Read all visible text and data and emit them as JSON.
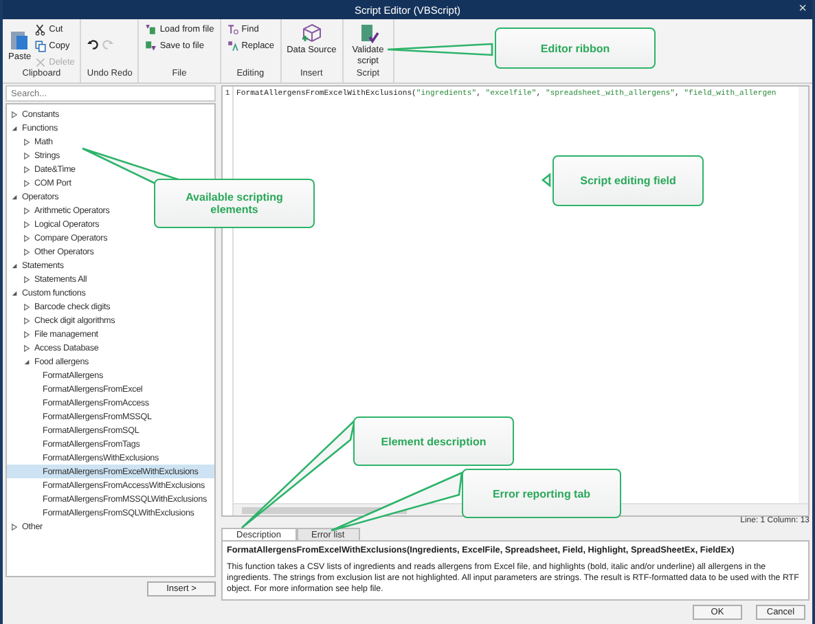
{
  "window": {
    "title": "Script Editor (VBScript)",
    "close": "×"
  },
  "ribbon": {
    "groups": [
      {
        "label": "Clipboard",
        "items": [
          {
            "kind": "large",
            "label": "Paste",
            "disabled": false
          },
          {
            "kind": "small",
            "label": "Cut",
            "disabled": false
          },
          {
            "kind": "small",
            "label": "Copy",
            "disabled": false
          },
          {
            "kind": "small",
            "label": "Delete",
            "disabled": true
          }
        ]
      },
      {
        "label": "Undo Redo",
        "items": [
          {
            "kind": "icon",
            "disabled": false
          },
          {
            "kind": "icon",
            "disabled": true
          }
        ]
      },
      {
        "label": "File",
        "items": [
          {
            "kind": "small",
            "label": "Load from file",
            "disabled": false
          },
          {
            "kind": "small",
            "label": "Save to file",
            "disabled": false
          }
        ]
      },
      {
        "label": "Editing",
        "items": [
          {
            "kind": "small",
            "label": "Find",
            "disabled": false
          },
          {
            "kind": "small",
            "label": "Replace",
            "disabled": false
          }
        ]
      },
      {
        "label": "Insert",
        "items": [
          {
            "kind": "large",
            "label": "Data Source",
            "disabled": false
          }
        ]
      },
      {
        "label": "Script",
        "items": [
          {
            "kind": "large",
            "label": "Validate script",
            "disabled": false
          }
        ]
      }
    ]
  },
  "tree": {
    "search": {
      "placeholder": "Search..."
    },
    "items": [
      {
        "label": "Constants",
        "expanded": false,
        "selected": false
      },
      {
        "label": "Functions",
        "expanded": true,
        "selected": false,
        "children": [
          {
            "label": "Math",
            "expanded": false,
            "selected": false
          },
          {
            "label": "Strings",
            "expanded": false,
            "selected": false
          },
          {
            "label": "Date&Time",
            "expanded": false,
            "selected": false
          },
          {
            "label": "COM Port",
            "expanded": false,
            "selected": false
          }
        ]
      },
      {
        "label": "Operators",
        "expanded": true,
        "selected": false,
        "children": [
          {
            "label": "Arithmetic Operators",
            "expanded": false,
            "selected": false
          },
          {
            "label": "Logical Operators",
            "expanded": false,
            "selected": false
          },
          {
            "label": "Compare Operators",
            "expanded": false,
            "selected": false
          },
          {
            "label": "Other Operators",
            "expanded": false,
            "selected": false
          }
        ]
      },
      {
        "label": "Statements",
        "expanded": true,
        "selected": false,
        "children": [
          {
            "label": "Statements All",
            "expanded": false,
            "selected": false
          }
        ]
      },
      {
        "label": "Custom functions",
        "expanded": true,
        "selected": false,
        "children": [
          {
            "label": "Barcode check digits",
            "expanded": false,
            "selected": false
          },
          {
            "label": "Check digit algorithms",
            "expanded": false,
            "selected": false
          },
          {
            "label": "File management",
            "expanded": false,
            "selected": false
          },
          {
            "label": "Access Database",
            "expanded": false,
            "selected": false
          },
          {
            "label": "Food allergens",
            "expanded": true,
            "selected": false,
            "children": [
              {
                "label": "FormatAllergens",
                "selected": false
              },
              {
                "label": "FormatAllergensFromExcel",
                "selected": false
              },
              {
                "label": "FormatAllergensFromAccess",
                "selected": false
              },
              {
                "label": "FormatAllergensFromMSSQL",
                "selected": false
              },
              {
                "label": "FormatAllergensFromSQL",
                "selected": false
              },
              {
                "label": "FormatAllergensFromTags",
                "selected": false
              },
              {
                "label": "FormatAllergensWithExclusions",
                "selected": false
              },
              {
                "label": "FormatAllergensFromExcelWithExclusions",
                "selected": true
              },
              {
                "label": "FormatAllergensFromAccessWithExclusions",
                "selected": false
              },
              {
                "label": "FormatAllergensFromMSSQLWithExclusions",
                "selected": false
              },
              {
                "label": "FormatAllergensFromSQLWithExclusions",
                "selected": false
              }
            ]
          }
        ]
      },
      {
        "label": "Other",
        "expanded": false,
        "selected": false
      }
    ],
    "insert_button": "Insert >"
  },
  "editor": {
    "line_number": "1",
    "code": [
      {
        "kind": "plain",
        "text": "FormatAllergensFromExcelWithExclusions("
      },
      {
        "kind": "string",
        "text": "\"ingredients\""
      },
      {
        "kind": "plain",
        "text": ", "
      },
      {
        "kind": "string",
        "text": "\"excelfile\""
      },
      {
        "kind": "plain",
        "text": ", "
      },
      {
        "kind": "string",
        "text": "\"spreadsheet_with_allergens\""
      },
      {
        "kind": "plain",
        "text": ", "
      },
      {
        "kind": "string",
        "text": "\"field_with_allergen"
      }
    ],
    "status": "Line: 1 Column: 13"
  },
  "bottom_tabs": [
    {
      "label": "Description",
      "selected": true
    },
    {
      "label": "Error list",
      "selected": false
    }
  ],
  "description": {
    "signature": "FormatAllergensFromExcelWithExclusions(Ingredients, ExcelFile, Spreadsheet, Field, Highlight, SpreadSheetEx, FieldEx)",
    "text": "This function takes a CSV lists of ingredients and reads allergens from Excel file, and highlights (bold, italic and/or underline) all allergens in the ingredients. The strings from exclusion list are not highlighted. All input parameters are strings. The result is RTF-formatted data to be used with the RTF object. For more information see help file."
  },
  "buttons": [
    "OK",
    "Cancel"
  ],
  "callouts": [
    "Editor ribbon",
    "Available scripting elements",
    "Script editing field",
    "Element description",
    "Error reporting tab"
  ]
}
